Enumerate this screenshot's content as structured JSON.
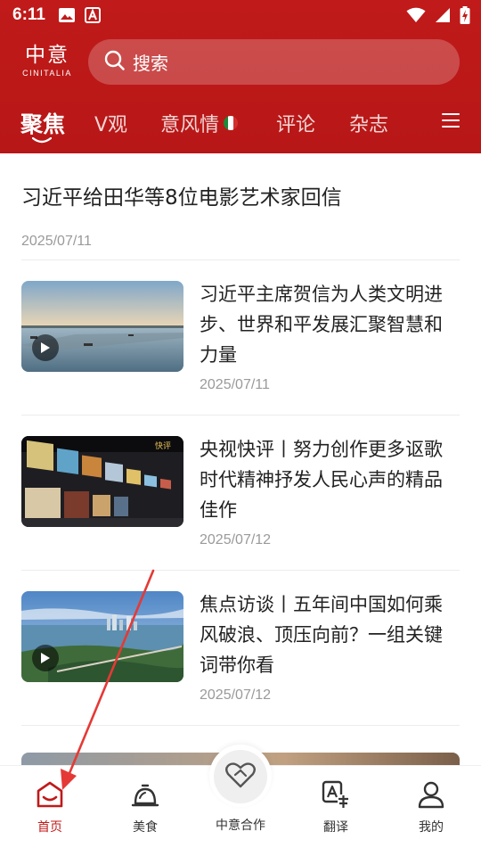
{
  "status_bar": {
    "time": "6:11"
  },
  "header": {
    "logo_main": "中意",
    "logo_sub": "CINITALIA",
    "search_label": "搜索",
    "tabs": [
      {
        "label": "聚焦",
        "active": true
      },
      {
        "label": "V观",
        "active": false
      },
      {
        "label": "意风情",
        "active": false,
        "flag": true
      },
      {
        "label": "评论",
        "active": false
      },
      {
        "label": "杂志",
        "active": false
      }
    ]
  },
  "feed": {
    "top_article": {
      "title": "习近平给田华等8位电影艺术家回信",
      "date": "2025/07/11"
    },
    "items": [
      {
        "title": "习近平主席贺信为人类文明进步、世界和平发展汇聚智慧和力量",
        "date": "2025/07/11",
        "video": true
      },
      {
        "title": "央视快评丨努力创作更多讴歌时代精神抒发人民心声的精品佳作",
        "date": "2025/07/12",
        "video": false
      },
      {
        "title": "焦点访谈丨五年间中国如何乘风破浪、顶压向前？一组关键词带你看",
        "date": "2025/07/12",
        "video": true
      }
    ]
  },
  "bottom_nav": {
    "items": [
      {
        "label": "首页",
        "icon": "home-icon",
        "active": true
      },
      {
        "label": "美食",
        "icon": "food-cloche-icon",
        "active": false
      },
      {
        "label": "中意合作",
        "icon": "cooperation-heart-icon",
        "active": false
      },
      {
        "label": "翻译",
        "icon": "translate-icon",
        "active": false
      },
      {
        "label": "我的",
        "icon": "profile-icon",
        "active": false
      }
    ]
  },
  "colors": {
    "brand_red": "#c01a1a",
    "text_dark": "#222222",
    "date_gray": "#9a9a9a",
    "annotation_arrow": "#e53935"
  }
}
